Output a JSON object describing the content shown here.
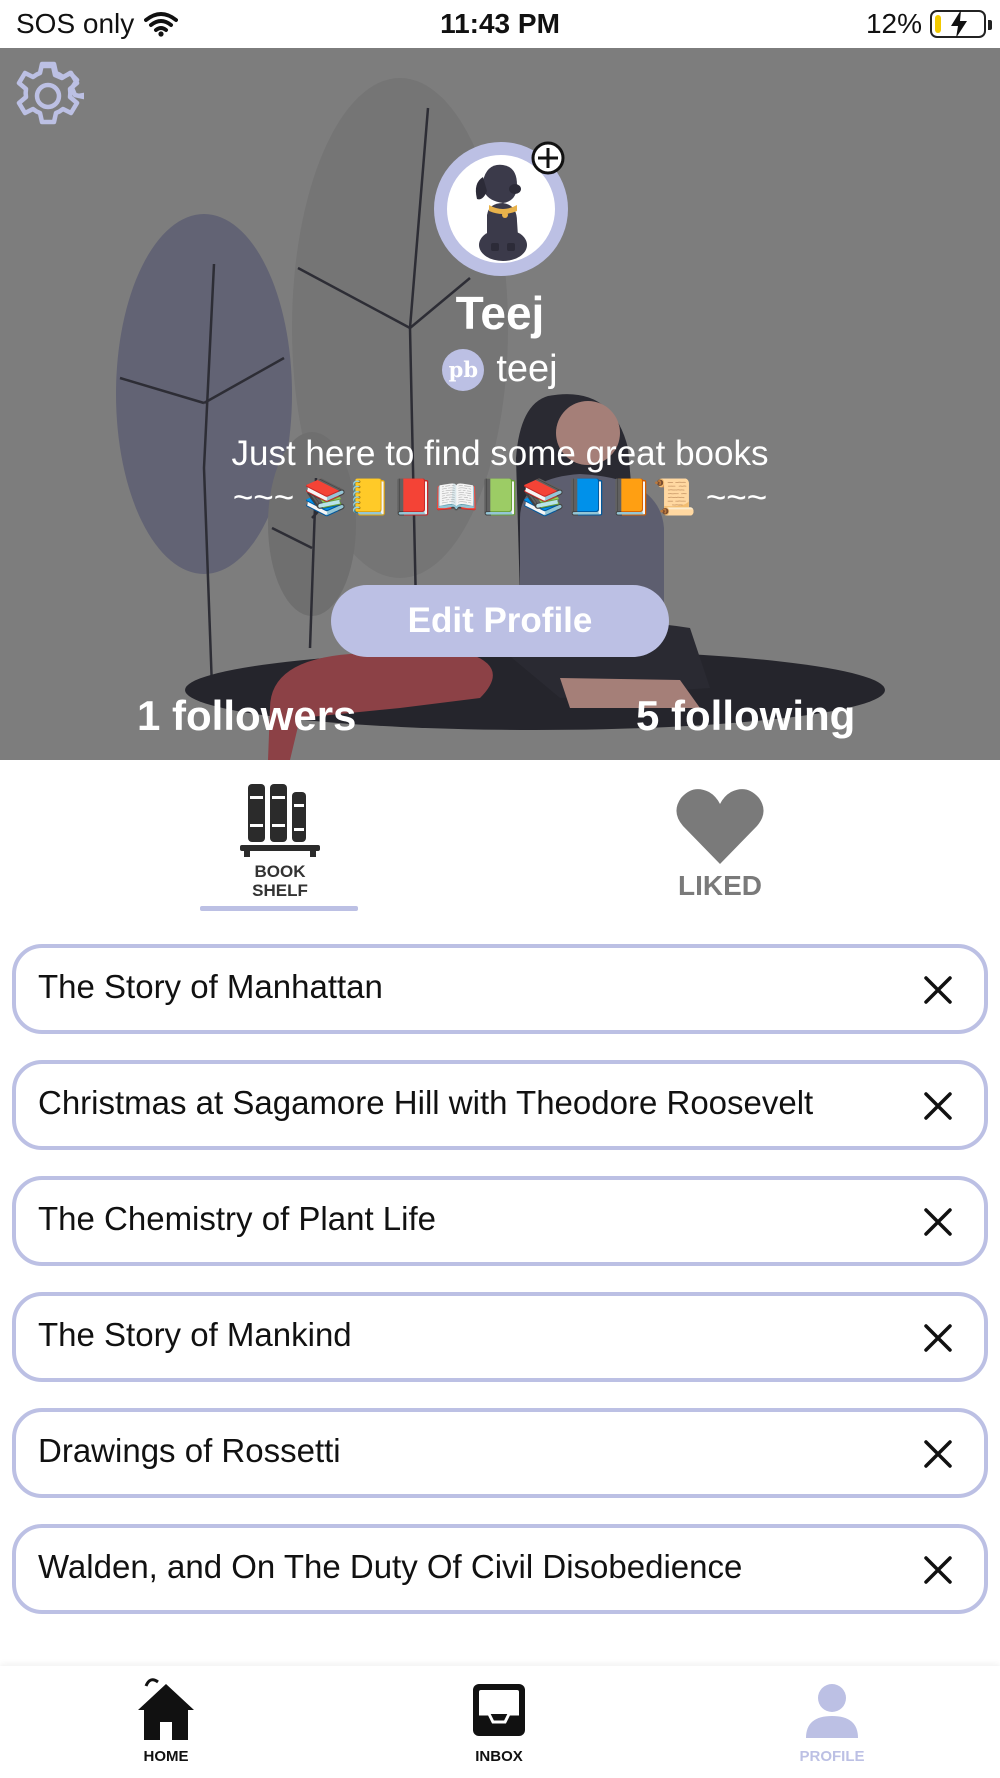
{
  "status_bar": {
    "carrier": "SOS only",
    "time": "11:43 PM",
    "battery_percent": "12%",
    "battery_level": 0.12,
    "icons": [
      "wifi-icon",
      "battery-charging-icon"
    ]
  },
  "profile": {
    "display_name": "Teej",
    "badge_text": "pb",
    "handle": "teej",
    "bio_line1": "Just here to find some great books",
    "bio_line2": "~~~ 📚📒📕📖📗📚📘📙📜 ~~~",
    "edit_button": "Edit Profile",
    "followers": "1 followers",
    "following": "5 following",
    "icons": [
      "settings-gear-icon",
      "add-photo-icon",
      "dog-avatar"
    ]
  },
  "tabs": {
    "bookshelf_line1": "BOOK",
    "bookshelf_line2": "SHELF",
    "liked": "LIKED",
    "active": "bookshelf"
  },
  "books": [
    {
      "title": "The Story of Manhattan"
    },
    {
      "title": "Christmas at Sagamore Hill with Theodore Roosevelt"
    },
    {
      "title": "The Chemistry of Plant Life"
    },
    {
      "title": "The Story of Mankind"
    },
    {
      "title": "Drawings of Rossetti"
    },
    {
      "title": "Walden, and On The Duty Of Civil Disobedience"
    }
  ],
  "bottom_nav": {
    "home": "HOME",
    "inbox": "INBOX",
    "profile": "PROFILE",
    "active": "profile"
  },
  "colors": {
    "accent": "#bcc0e4",
    "header_bg": "#7d7d7d",
    "illustration_dark": "#5e5f70",
    "illustration_red": "#8c4146"
  }
}
